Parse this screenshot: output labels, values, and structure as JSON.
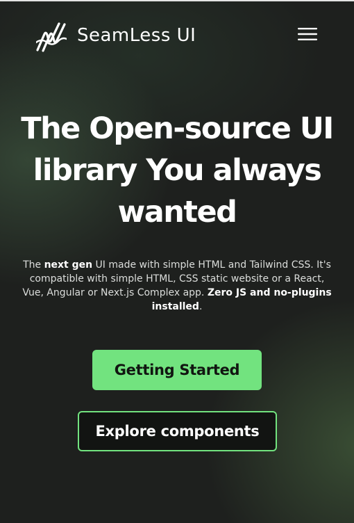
{
  "header": {
    "brand_name": "SeamLess UI",
    "logo_icon": "wave-zigzag-logo-icon",
    "menu_icon": "hamburger-menu-icon"
  },
  "hero": {
    "title": "The Open-source UI library You always wanted",
    "description": {
      "part1": "The ",
      "bold1": "next gen",
      "part2": " UI made with simple HTML and Tailwind CSS. It's compatible with simple HTML, CSS static website or a React, Vue, Angular or Next.js Complex app. ",
      "bold2": "Zero JS and no-plugins installed",
      "part3": "."
    },
    "primary_button": "Getting Started",
    "secondary_button": "Explore components"
  },
  "colors": {
    "accent": "#72e37f",
    "background": "#1e201e",
    "text": "#ffffff"
  }
}
